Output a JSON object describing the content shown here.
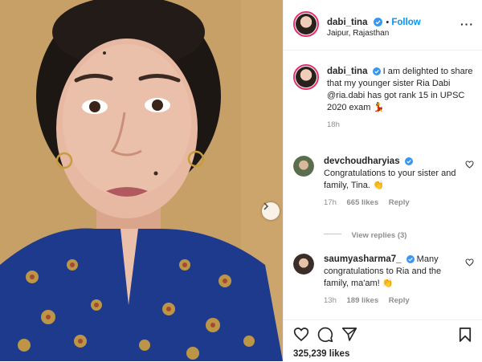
{
  "post": {
    "author": "dabi_tina",
    "follow_label": "Follow",
    "location": "Jaipur, Rajasthan",
    "more_icon": "more-horizontal-icon",
    "caption": {
      "username": "dabi_tina",
      "text": "I am delighted to share that my younger sister Ria Dabi @ria.dabi has got rank 15 in UPSC 2020 exam",
      "emoji": "💃",
      "time": "18h"
    },
    "comments": [
      {
        "username": "devchoudharyias",
        "verified": true,
        "text": "Congratulations to your sister and family, Tina.",
        "emoji": "👏",
        "time": "17h",
        "likes": "665 likes",
        "reply_label": "Reply",
        "view_replies": "View replies (3)"
      },
      {
        "username": "saumyasharma7_",
        "verified": true,
        "text": "Many congratulations to Ria and the family, ma'am!",
        "emoji": "👏",
        "time": "13h",
        "likes": "189 likes",
        "reply_label": "Reply"
      }
    ],
    "likes_count": "325,239 likes",
    "colors": {
      "accent": "#0095f6",
      "text": "#262626",
      "muted": "#8e8e8e",
      "ring": "#e1306c"
    }
  }
}
